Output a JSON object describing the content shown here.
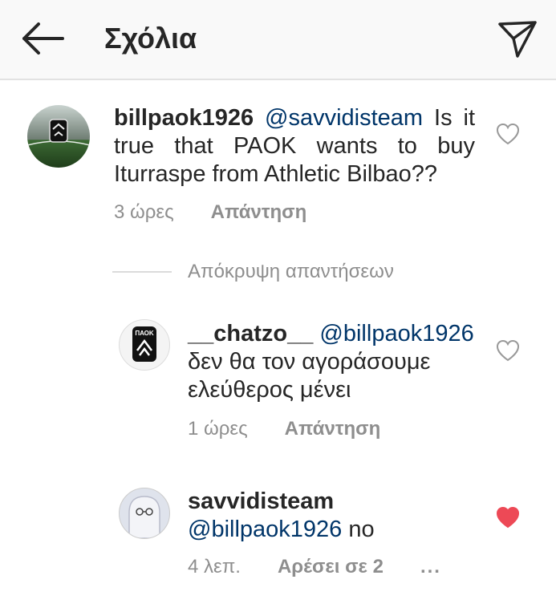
{
  "header": {
    "title": "Σχόλια",
    "back_icon": "arrow-left-icon",
    "send_icon": "paper-plane-icon"
  },
  "comments": [
    {
      "username": "billpaok1926",
      "mention": "@savvidisteam",
      "text": " Is it true that PAOK wants to buy Iturraspe from Athletic Bilbao??",
      "time": "3 ώρες",
      "reply_label": "Απάντηση",
      "liked": false
    },
    {
      "username": "__chatzo__",
      "mention": "@billpaok1926",
      "text": " δεν θα τον αγοράσουμε ελεύθερος μένει",
      "time": "1 ώρες",
      "reply_label": "Απάντηση",
      "liked": false
    },
    {
      "username": "savvidisteam",
      "mention": "@billpaok1926",
      "text": " no",
      "time": "4 λεπ.",
      "likes_label": "Αρέσει σε 2",
      "more_label": "...",
      "liked": true
    }
  ],
  "replies_toggle": "Απόκρυψη απαντήσεων",
  "avatar_badge": "ΠΑΟΚ",
  "colors": {
    "mention": "#003569",
    "heart_liked": "#ed4956",
    "muted": "#8e8e8e",
    "header_bg": "#f9f9f9"
  }
}
